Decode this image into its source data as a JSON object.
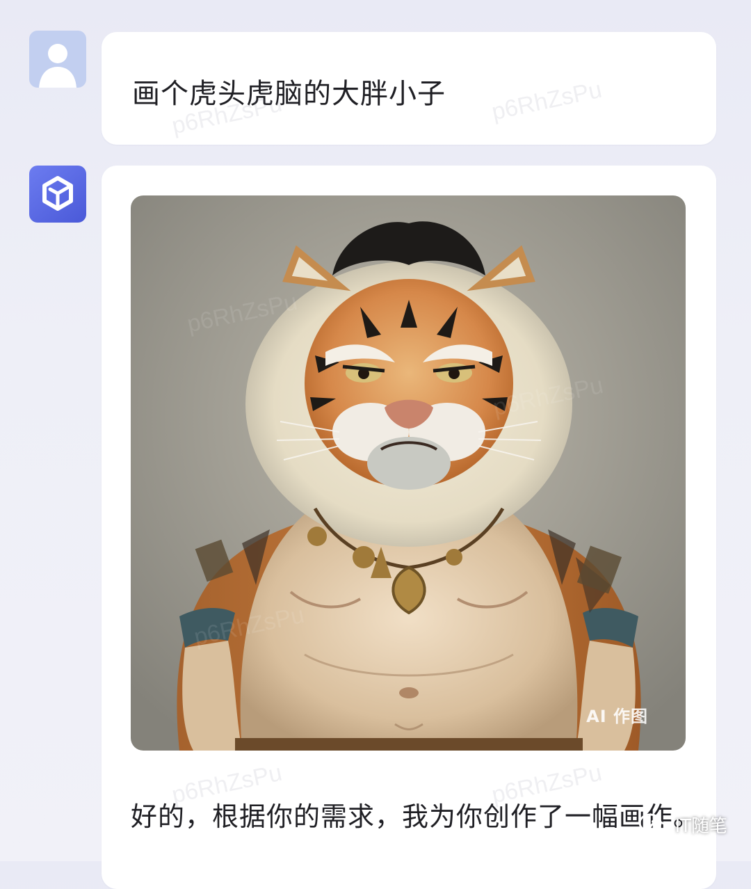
{
  "conversation": {
    "user_message": "画个虎头虎脑的大胖小子",
    "bot_image_badge": "AI 作图",
    "bot_reply": "好的，根据你的需求，我为你创作了一幅画作。",
    "watermark": "p6RhZsPu"
  },
  "icons": {
    "user_avatar": "person-icon",
    "bot_avatar": "cube-logo-icon",
    "brand": "wechat-icon"
  },
  "footer": {
    "brand_label": "IT随笔"
  },
  "colors": {
    "accent": "#5564e4",
    "user_avatar_bg": "#c2cff0",
    "page_bg": "#eceef7"
  }
}
